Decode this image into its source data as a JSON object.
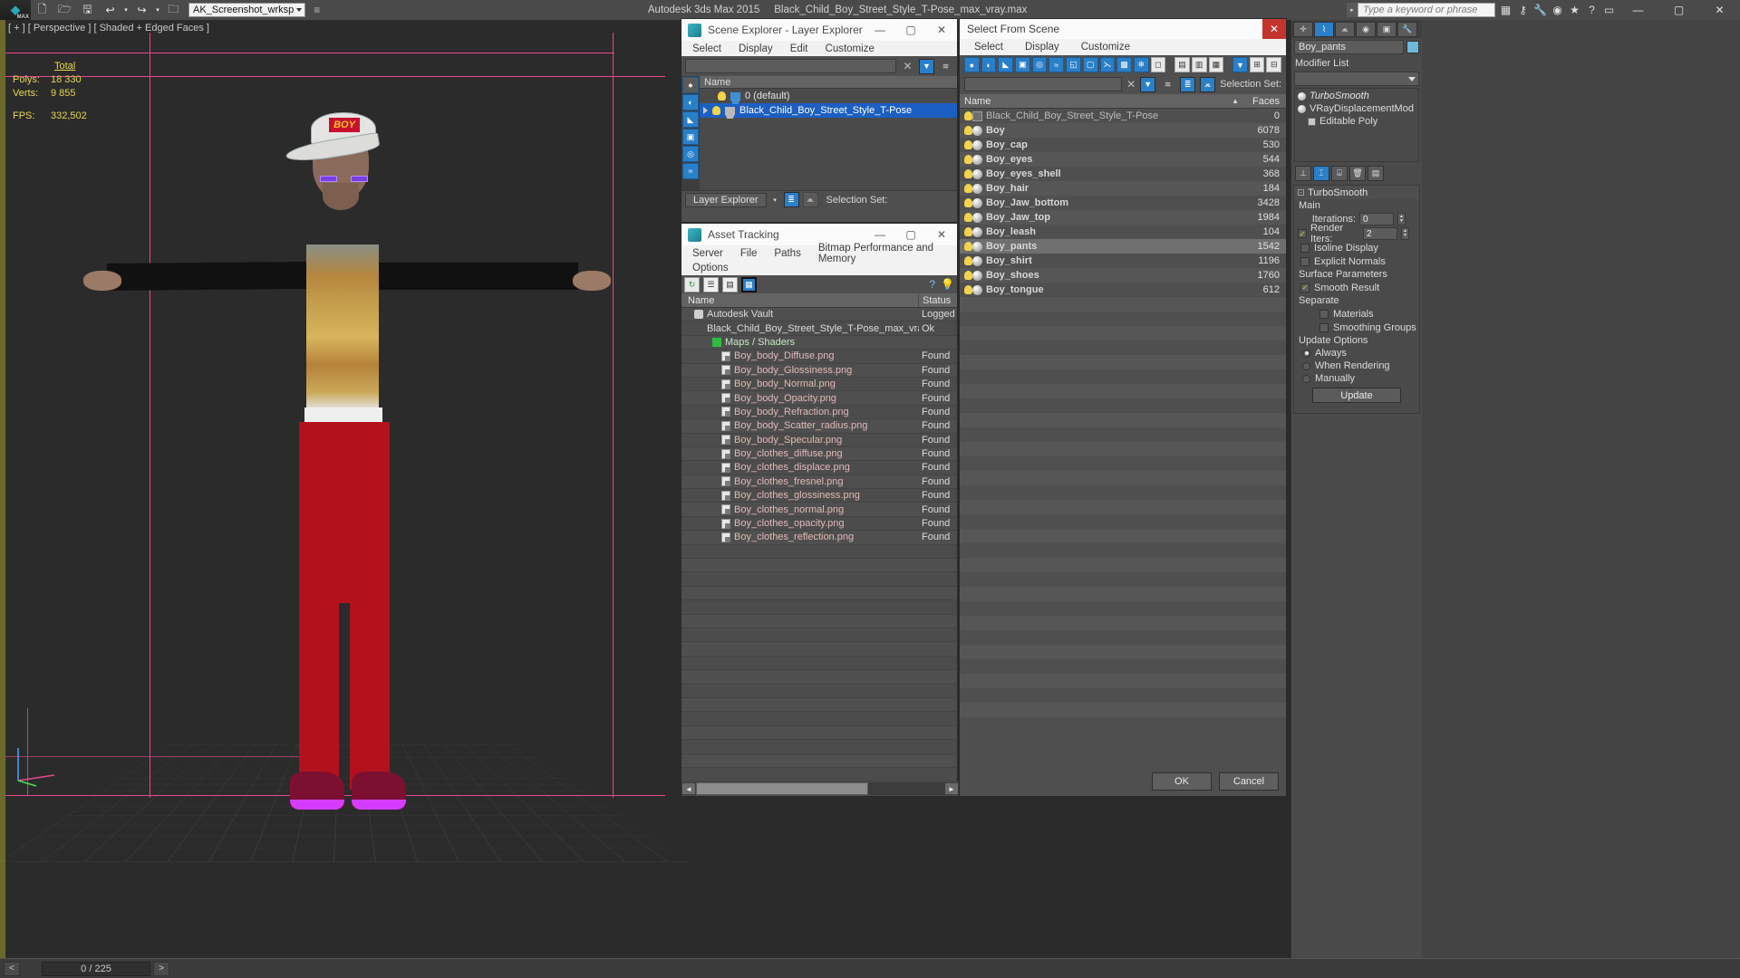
{
  "titlebar": {
    "app_icon": "3dsmax-logo-icon",
    "tools": [
      "new-file-icon",
      "open-file-icon",
      "save-file-icon",
      "undo-icon",
      "undo-dropdown-icon",
      "redo-icon",
      "redo-dropdown-icon",
      "project-folder-icon"
    ],
    "workspace": "AK_Screenshot_wrksp",
    "app_title": "Autodesk 3ds Max  2015",
    "file_title": "Black_Child_Boy_Street_Style_T-Pose_max_vray.max",
    "search_placeholder": "Type a keyword or phrase",
    "right_icons": [
      "workspace-grid-icon",
      "key-icon",
      "wrench-icon",
      "info-icon",
      "star-icon",
      "help-icon"
    ],
    "window_buttons": [
      "minimize",
      "maximize",
      "close"
    ]
  },
  "viewport": {
    "label": "[ + ] [ Perspective ] [ Shaded + Edged Faces ]",
    "stats": {
      "total_label": "Total",
      "polys_label": "Polys:",
      "polys_value": "18 330",
      "verts_label": "Verts:",
      "verts_value": "9 855",
      "fps_label": "FPS:",
      "fps_value": "332,502"
    },
    "cap_logo": "BOY"
  },
  "statusbar": {
    "prev_frame": "<",
    "frame_counter": "0 / 225",
    "next_frame": ">"
  },
  "scene_explorer": {
    "title": "Scene Explorer - Layer Explorer",
    "menus": [
      "Select",
      "Display",
      "Edit",
      "Customize"
    ],
    "toolbar_icons": [
      "filter-funnel-icon",
      "layers-remove-icon",
      "clear-x-icon"
    ],
    "side_icons": [
      "geometry-sphere-icon",
      "shapes-icon",
      "lights-icon",
      "cameras-icon",
      "helpers-icon",
      "spacewarps-icon"
    ],
    "column_header": "Name",
    "rows": [
      {
        "name": "0 (default)",
        "selected": false,
        "expandable": false,
        "layer_icon": "layer-blue-icon"
      },
      {
        "name": "Black_Child_Boy_Street_Style_T-Pose",
        "selected": true,
        "expandable": true,
        "layer_icon": "layer-gray-icon"
      }
    ],
    "footer": {
      "tab": "Layer Explorer",
      "selection_set_label": "Selection Set:"
    }
  },
  "asset_tracking": {
    "title": "Asset Tracking",
    "menus": [
      "Server",
      "File",
      "Paths",
      "Bitmap Performance and Memory",
      "Options"
    ],
    "toolbar_icons": [
      "refresh-icon",
      "list-view-icon",
      "details-view-icon",
      "grid-view-icon"
    ],
    "help_icons": [
      "help-icon",
      "bulb-icon"
    ],
    "columns": [
      "Name",
      "Status"
    ],
    "rows": [
      {
        "name": "Autodesk Vault",
        "status": "Logged",
        "indent": 1,
        "icon": "vault-icon"
      },
      {
        "name": "Black_Child_Boy_Street_Style_T-Pose_max_vray....",
        "status": "Ok",
        "indent": 2,
        "icon": "max-file-icon"
      },
      {
        "name": "Maps / Shaders",
        "status": "",
        "indent": 3,
        "icon": "maps-icon"
      },
      {
        "name": "Boy_body_Diffuse.png",
        "status": "Found",
        "indent": 4,
        "icon": "bitmap-icon"
      },
      {
        "name": "Boy_body_Glossiness.png",
        "status": "Found",
        "indent": 4,
        "icon": "bitmap-icon"
      },
      {
        "name": "Boy_body_Normal.png",
        "status": "Found",
        "indent": 4,
        "icon": "bitmap-icon"
      },
      {
        "name": "Boy_body_Opacity.png",
        "status": "Found",
        "indent": 4,
        "icon": "bitmap-icon"
      },
      {
        "name": "Boy_body_Refraction.png",
        "status": "Found",
        "indent": 4,
        "icon": "bitmap-icon"
      },
      {
        "name": "Boy_body_Scatter_radius.png",
        "status": "Found",
        "indent": 4,
        "icon": "bitmap-icon"
      },
      {
        "name": "Boy_body_Specular.png",
        "status": "Found",
        "indent": 4,
        "icon": "bitmap-icon"
      },
      {
        "name": "Boy_clothes_diffuse.png",
        "status": "Found",
        "indent": 4,
        "icon": "bitmap-icon"
      },
      {
        "name": "Boy_clothes_displace.png",
        "status": "Found",
        "indent": 4,
        "icon": "bitmap-icon"
      },
      {
        "name": "Boy_clothes_fresnel.png",
        "status": "Found",
        "indent": 4,
        "icon": "bitmap-icon"
      },
      {
        "name": "Boy_clothes_glossiness.png",
        "status": "Found",
        "indent": 4,
        "icon": "bitmap-icon"
      },
      {
        "name": "Boy_clothes_normal.png",
        "status": "Found",
        "indent": 4,
        "icon": "bitmap-icon"
      },
      {
        "name": "Boy_clothes_opacity.png",
        "status": "Found",
        "indent": 4,
        "icon": "bitmap-icon"
      },
      {
        "name": "Boy_clothes_reflection.png",
        "status": "Found",
        "indent": 4,
        "icon": "bitmap-icon"
      }
    ]
  },
  "select_from_scene": {
    "title": "Select From Scene",
    "menus": [
      "Select",
      "Display",
      "Customize"
    ],
    "toolbar_icons": [
      "geometry-icon",
      "shapes-icon",
      "lights-icon",
      "cameras-icon",
      "helpers-icon",
      "spacewarps-icon",
      "groups-icon",
      "xrefs-icon",
      "bones-icon",
      "particles-icon",
      "container-icon",
      "freeze-icon",
      "display-flat-icon",
      "display-layer-icon",
      "display-hier-icon",
      "filter-funnel-icon",
      "expand-all-icon",
      "collapse-all-icon"
    ],
    "search_placeholder": "",
    "selection_set_label": "Selection Set:",
    "columns": {
      "name": "Name",
      "faces": "Faces"
    },
    "sort_indicator": "▲",
    "rows": [
      {
        "name": "Black_Child_Boy_Street_Style_T-Pose",
        "faces": "0",
        "icon": "group-icon",
        "root": true,
        "selected": false
      },
      {
        "name": "Boy",
        "faces": "6078",
        "icon": "sphere-icon",
        "root": false,
        "selected": false
      },
      {
        "name": "Boy_cap",
        "faces": "530",
        "icon": "sphere-icon",
        "root": false,
        "selected": false
      },
      {
        "name": "Boy_eyes",
        "faces": "544",
        "icon": "sphere-icon",
        "root": false,
        "selected": false
      },
      {
        "name": "Boy_eyes_shell",
        "faces": "368",
        "icon": "sphere-icon",
        "root": false,
        "selected": false
      },
      {
        "name": "Boy_hair",
        "faces": "184",
        "icon": "sphere-icon",
        "root": false,
        "selected": false
      },
      {
        "name": "Boy_Jaw_bottom",
        "faces": "3428",
        "icon": "sphere-icon",
        "root": false,
        "selected": false
      },
      {
        "name": "Boy_Jaw_top",
        "faces": "1984",
        "icon": "sphere-icon",
        "root": false,
        "selected": false
      },
      {
        "name": "Boy_leash",
        "faces": "104",
        "icon": "sphere-icon",
        "root": false,
        "selected": false
      },
      {
        "name": "Boy_pants",
        "faces": "1542",
        "icon": "sphere-icon",
        "root": false,
        "selected": true
      },
      {
        "name": "Boy_shirt",
        "faces": "1196",
        "icon": "sphere-icon",
        "root": false,
        "selected": false
      },
      {
        "name": "Boy_shoes",
        "faces": "1760",
        "icon": "sphere-icon",
        "root": false,
        "selected": false
      },
      {
        "name": "Boy_tongue",
        "faces": "612",
        "icon": "sphere-icon",
        "root": false,
        "selected": false
      }
    ],
    "ok_label": "OK",
    "cancel_label": "Cancel"
  },
  "command_panel": {
    "tabs": [
      "create-tab",
      "modify-tab",
      "hierarchy-tab",
      "motion-tab",
      "display-tab",
      "utilities-tab"
    ],
    "active_tab_index": 1,
    "object_name": "Boy_pants",
    "object_color": "#6fb9d8",
    "modifier_list_label": "Modifier List",
    "stack": [
      {
        "label": "TurboSmooth",
        "type": "modifier"
      },
      {
        "label": "VRayDisplacementMod",
        "type": "modifier"
      },
      {
        "label": "Editable Poly",
        "type": "base"
      }
    ],
    "stack_tools": [
      "pin-stack-icon",
      "show-end-result-icon",
      "make-unique-icon",
      "remove-modifier-icon",
      "configure-sets-icon"
    ],
    "rollouts": [
      {
        "title": "TurboSmooth",
        "sections": [
          {
            "label": "Main"
          },
          {
            "type": "spinner",
            "label": "Iterations:",
            "value": "0"
          },
          {
            "type": "checkbox",
            "label": "Render Iters:",
            "checked": true,
            "value": "2"
          },
          {
            "type": "checkbox",
            "label": "Isoline Display",
            "checked": false
          },
          {
            "type": "checkbox",
            "label": "Explicit Normals",
            "checked": false
          },
          {
            "label": "Surface Parameters"
          },
          {
            "type": "checkbox",
            "label": "Smooth Result",
            "checked": true
          },
          {
            "label": "Separate"
          },
          {
            "type": "checkbox",
            "label": "Materials",
            "checked": false
          },
          {
            "type": "checkbox",
            "label": "Smoothing Groups",
            "checked": false
          },
          {
            "label": "Update Options"
          },
          {
            "type": "radio",
            "label": "Always",
            "checked": true
          },
          {
            "type": "radio",
            "label": "When Rendering",
            "checked": false
          },
          {
            "type": "radio",
            "label": "Manually",
            "checked": false
          },
          {
            "type": "button",
            "label": "Update"
          }
        ]
      }
    ]
  }
}
